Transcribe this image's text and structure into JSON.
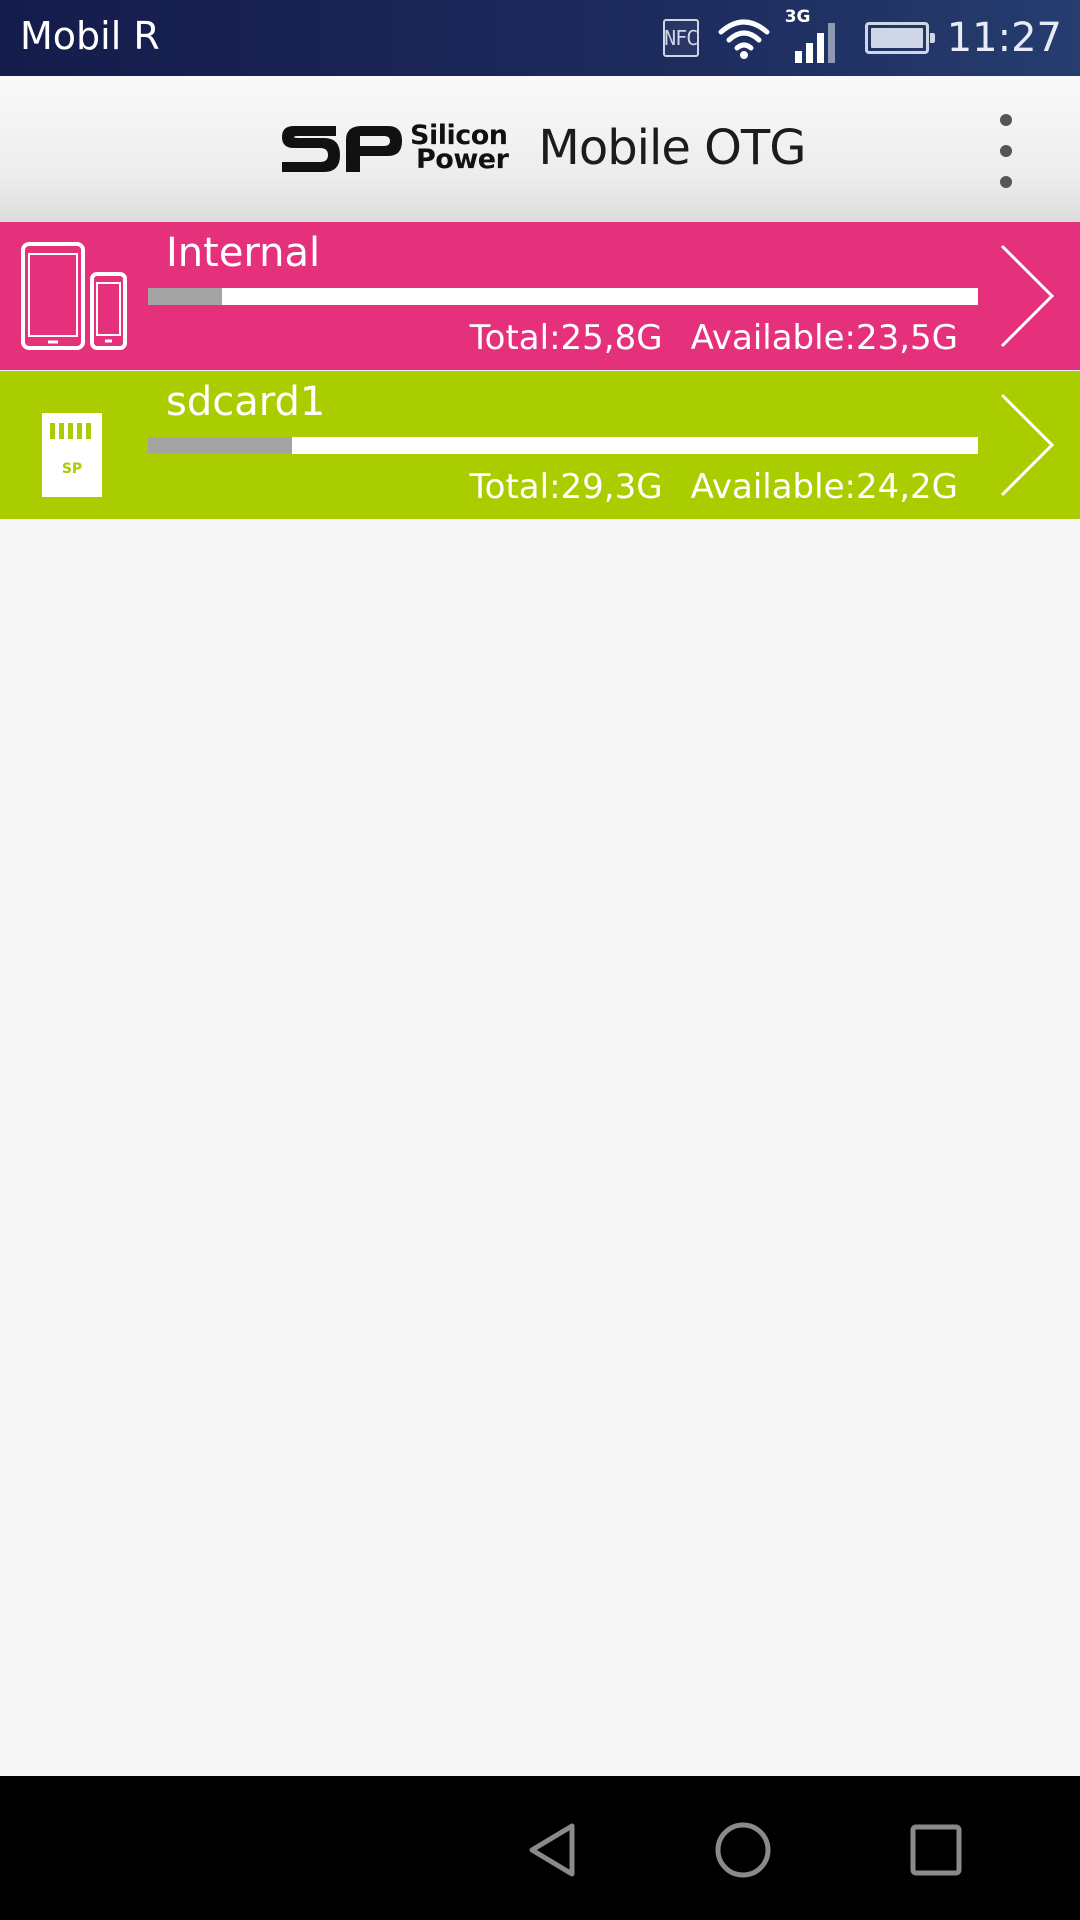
{
  "status_bar": {
    "carrier": "Mobil R",
    "nfc_label": "NFC",
    "network_type": "3G",
    "time": "11:27",
    "icons": [
      "nfc-icon",
      "wifi-icon",
      "signal-icon",
      "battery-icon"
    ]
  },
  "header": {
    "logo_line1": "Silicon",
    "logo_line2": "Power",
    "title_part1": "Mobile ",
    "title_part2": "OTG",
    "menu_icon": "overflow-menu-icon"
  },
  "storages": [
    {
      "name": "Internal",
      "total": "Total:25,8G",
      "available": "Available:23,5G",
      "used_fraction": 0.089,
      "icon": "tablet-phone-icon",
      "color": "#e5317c"
    },
    {
      "name": "sdcard1",
      "total": "Total:29,3G",
      "available": "Available:24,2G",
      "used_fraction": 0.174,
      "icon": "sd-card-icon",
      "color": "#aacd00"
    }
  ],
  "nav_bar": {
    "buttons": [
      "back-icon",
      "home-icon",
      "recents-icon"
    ]
  }
}
